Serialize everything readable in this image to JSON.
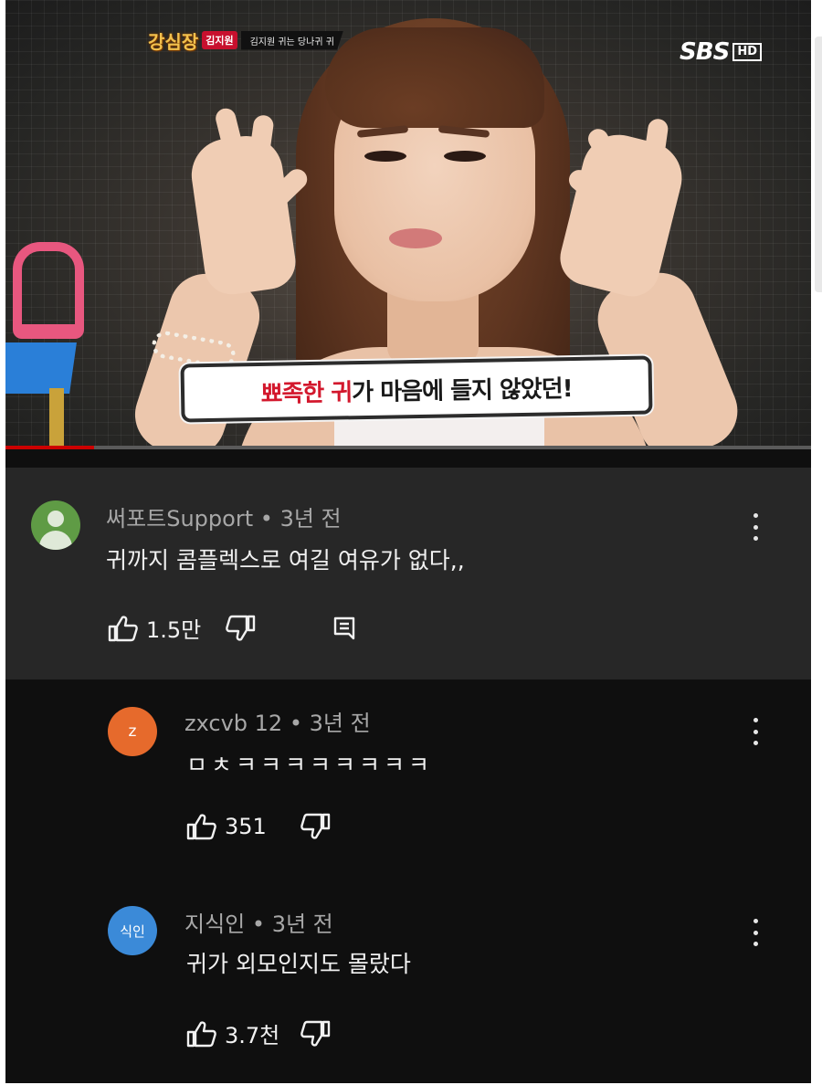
{
  "video": {
    "show_logo": "강심장",
    "guest_name": "김지원",
    "topic": "김지원 귀는 당나귀 귀",
    "broadcaster": "SBS",
    "quality_badge": "HD",
    "caption_red": "뾰족한 귀",
    "caption_dark": "가 마음에 들지 않았던!",
    "progress_percent": 11
  },
  "comments": [
    {
      "author": "써포트Support",
      "time": "3년 전",
      "text": "귀까지 콤플렉스로 여길 여유가 없다,,",
      "likes": "1.5만",
      "avatar_type": "default-person",
      "avatar_color": "#5f9b45"
    },
    {
      "author": "zxcvb 12",
      "time": "3년 전",
      "text": "ㅁㅊㅋㅋㅋㅋㅋㅋㅋㅋ",
      "likes": "351",
      "avatar_letter": "z",
      "avatar_color": "#e66a2c"
    },
    {
      "author": "지식인",
      "time": "3년 전",
      "text": "귀가 외모인지도 몰랐다",
      "likes": "3.7천",
      "avatar_letter": "식인",
      "avatar_color": "#3b8ad8"
    }
  ],
  "separator": "•",
  "icons": {
    "like": "thumbs-up-icon",
    "dislike": "thumbs-down-icon",
    "reply": "reply-icon",
    "more": "more-vert-icon"
  }
}
